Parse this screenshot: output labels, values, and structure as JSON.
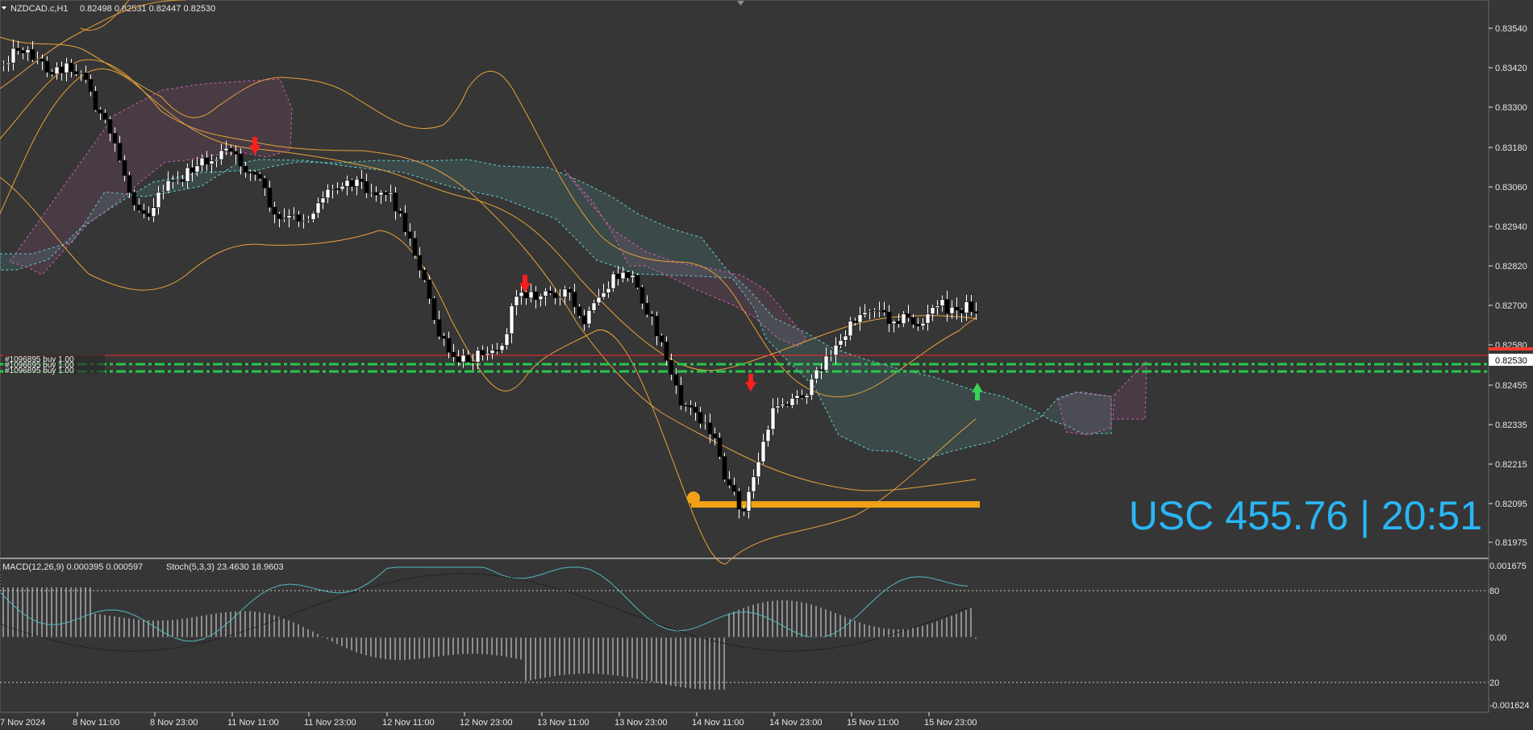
{
  "window": {
    "symbol_timeframe": "NZDCAD.c,H1",
    "ohlc": "0.82498 0.82531 0.82447 0.82530"
  },
  "price_axis": {
    "labels": [
      "0.83540",
      "0.83420",
      "0.83300",
      "0.83180",
      "0.83060",
      "0.82940",
      "0.82820",
      "0.82700",
      "0.82580",
      "0.82455",
      "0.82335",
      "0.82215",
      "0.82095",
      "0.81975"
    ],
    "current_price": "0.82530",
    "bid_color": "#ff3b30"
  },
  "time_axis": {
    "labels": [
      "7 Nov 2024",
      "8 Nov 11:00",
      "8 Nov 23:00",
      "11 Nov 11:00",
      "11 Nov 23:00",
      "12 Nov 11:00",
      "12 Nov 23:00",
      "13 Nov 11:00",
      "13 Nov 23:00",
      "14 Nov 11:00",
      "14 Nov 23:00",
      "15 Nov 11:00",
      "15 Nov 23:00"
    ]
  },
  "overlay": {
    "account": "USC 455.76 | 20:51",
    "account_color": "#29b6f6"
  },
  "order_labels": {
    "line1": "#1096895 buy 1.00",
    "line2": "#1096895 buy 1.00",
    "line3": "#1096895 buy 1.00"
  },
  "indicators": {
    "macd": "MACD(12,26,9) 0.000395 0.000597",
    "stoch": "Stoch(5,3,3) 23.4630 18.9603",
    "sub_axis": [
      "0.001675",
      "80",
      "0.00",
      "20",
      "-0.001624"
    ]
  },
  "colors": {
    "bg": "#363636",
    "bollinger": "#e6a13a",
    "kumo_bull": "#5fd3d0",
    "kumo_bear": "#d15fae",
    "arrow_down": "#ff1e1e",
    "arrow_up": "#39d353",
    "order_line": "#27c94b",
    "stop_line": "#f1a116",
    "stoch": "#51b8c1",
    "macd_hist": "#e6e6e6"
  }
}
